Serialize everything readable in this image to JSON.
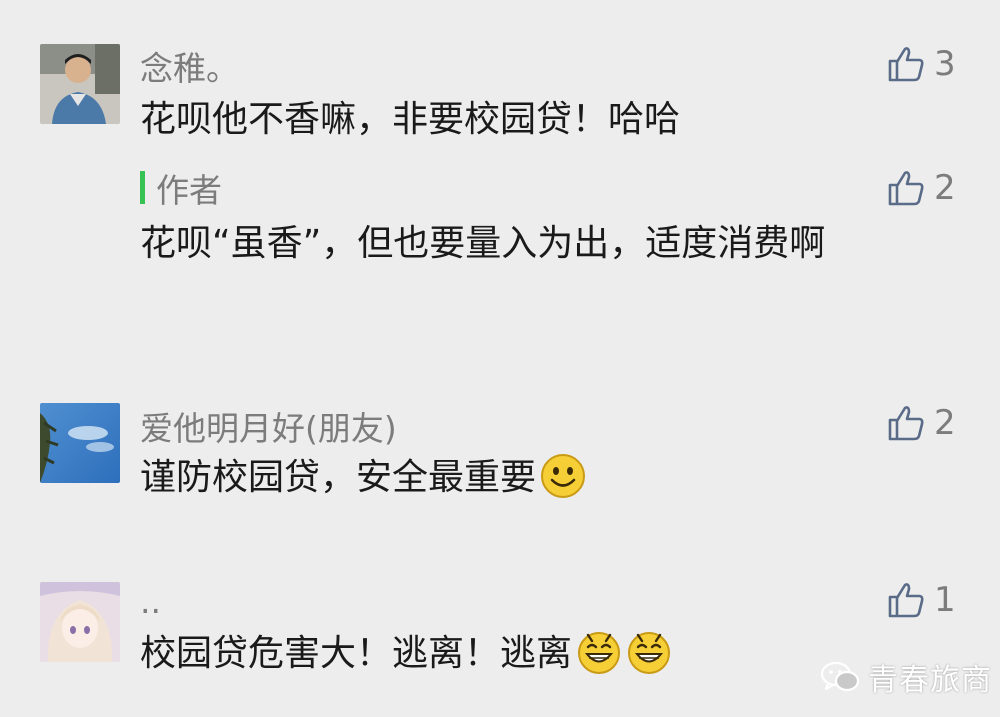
{
  "comments": [
    {
      "nickname": "念稚。",
      "text": "花呗他不香嘛，非要校园贷！哈哈",
      "likes": "3",
      "avatar_icon": "avatar-man-photo-icon",
      "reply": {
        "author_label": "作者",
        "text": "花呗“虽香”，但也要量入为出，适度消费啊",
        "likes": "2"
      }
    },
    {
      "nickname": "爱他明月好(朋友)",
      "text": "谨防校园贷，安全最重要",
      "likes": "2",
      "avatar_icon": "avatar-sky-tree-icon",
      "emoji": [
        "smile-emoji-icon"
      ]
    },
    {
      "nickname": "..",
      "text": "校园贷危害大！逃离！逃离",
      "likes": "1",
      "avatar_icon": "avatar-anime-girl-icon",
      "emoji": [
        "grin-emoji-icon",
        "grin-emoji-icon"
      ]
    }
  ],
  "watermark": {
    "text": "青春旅商",
    "icon": "wechat-icon"
  },
  "colors": {
    "background": "#ededed",
    "nickname": "#7c7c7c",
    "text": "#1a1a1a",
    "author_bar": "#36c353",
    "like_icon": "#5a6b88"
  }
}
